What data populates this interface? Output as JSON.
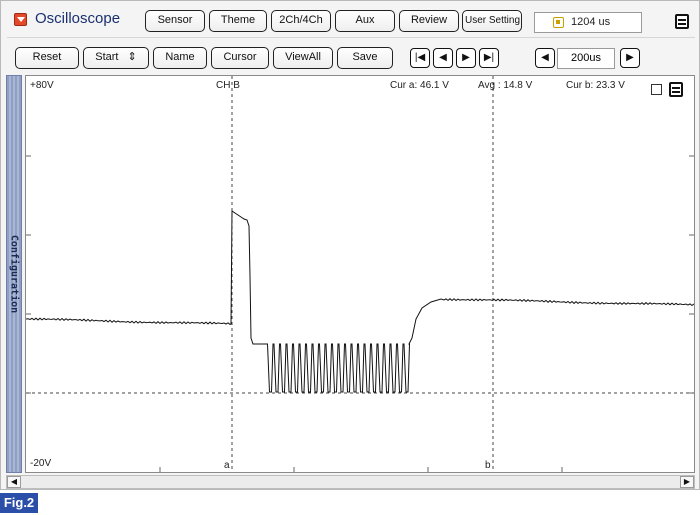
{
  "app": {
    "title": "Oscilloscope",
    "colors": {
      "accent": "#e34a2b",
      "title": "#1a3070",
      "figure_label_bg": "#2b4ea8"
    }
  },
  "toolbar_top": {
    "buttons": [
      "Sensor",
      "Theme",
      "2Ch/4Ch",
      "Aux",
      "Review",
      "User Setting"
    ],
    "time_readout": "1204 us",
    "time_icon": "clock-icon",
    "panel_icon": "panel-menu-icon"
  },
  "toolbar_bottom": {
    "buttons": [
      "Reset",
      "Start",
      "Name",
      "Cursor",
      "ViewAll",
      "Save"
    ],
    "start_suffix": "⇕",
    "nav_icons": [
      "skip-first-icon",
      "step-back-icon",
      "step-forward-icon",
      "skip-last-icon"
    ],
    "nav_glyphs": [
      "|◀",
      "◀",
      "▶",
      "▶|"
    ],
    "timebase_prev_glyph": "◀",
    "timebase_next_glyph": "▶",
    "timebase": "200us"
  },
  "sidebar": {
    "label": "Configuration"
  },
  "plot": {
    "top_label": "+80V",
    "bottom_label": "-20V",
    "channel_label": "CH B",
    "cursor_a_readout": "Cur a: 46.1 V",
    "avg_readout": "Avg : 14.8 V",
    "cursor_b_readout": "Cur b: 23.3 V",
    "cursor_a_marker": "a",
    "cursor_b_marker": "b",
    "panel_icon": "panel-menu-icon"
  },
  "scrollbar": {
    "left_glyph": "◀",
    "right_glyph": "▶"
  },
  "figure": {
    "label": "Fig.2"
  }
}
